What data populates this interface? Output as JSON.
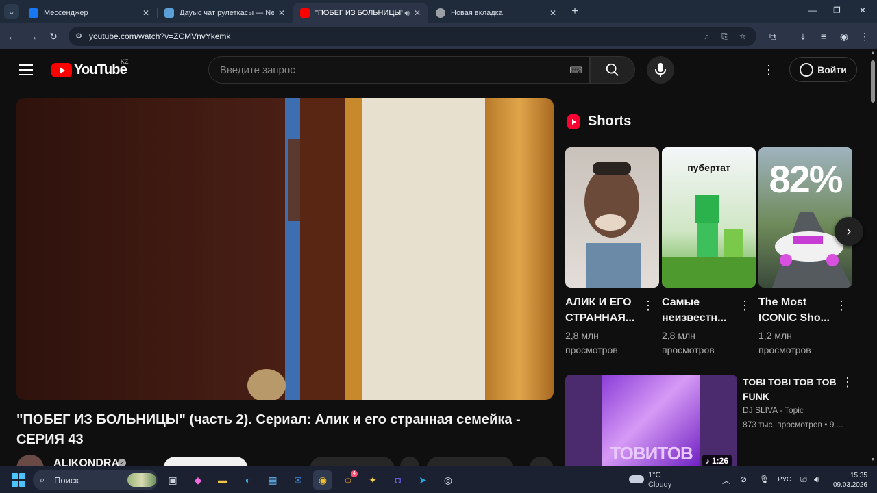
{
  "browser": {
    "tabs": [
      {
        "label": "Мессенджер",
        "favicon_color": "#1877f2"
      },
      {
        "label": "Дауыс чат рулеткасы — Nekto",
        "favicon_color": "#5aa0d6"
      },
      {
        "label": "\"ПОБЕГ ИЗ БОЛЬНИЦЫ\" (ч",
        "favicon_color": "#ff0000"
      },
      {
        "label": "Новая вкладка",
        "favicon_color": "#9aa0a6"
      }
    ],
    "url": "youtube.com/watch?v=ZCMVnvYkemk"
  },
  "header": {
    "logo_text": "YouTube",
    "country_code": "KZ",
    "search_placeholder": "Введите запрос",
    "signin_label": "Войти"
  },
  "video": {
    "title": "\"ПОБЕГ ИЗ БОЛЬНИЦЫ\" (часть 2). Сериал: Алик и его странная семейка - СЕРИЯ 43",
    "channel": "ALIKONDRA"
  },
  "shorts": {
    "section_title": "Shorts",
    "items": [
      {
        "title_line1": "АЛИК И ЕГО",
        "title_line2": "СТРАННАЯ...",
        "views_line1": "2,8 млн",
        "views_line2": "просмотров"
      },
      {
        "title_line1": "Самые",
        "title_line2": "неизвестн...",
        "views_line1": "2,8 млн",
        "views_line2": "просмотров",
        "thumb_text": "пубертат"
      },
      {
        "title_line1": "The Most",
        "title_line2": "ICONIC Sho...",
        "views_line1": "1,2 млн",
        "views_line2": "просмотров",
        "thumb_text": "82%"
      }
    ]
  },
  "recommended": {
    "title": "TOBI TOBI TOB TOB FUNK",
    "channel": "DJ SLIVA - Topic",
    "views": "873 тыс. просмотров • 9 ...",
    "duration": "1:26",
    "thumb_text": "TOBИTOB"
  },
  "taskbar": {
    "search_label": "Поиск",
    "weather_temp": "1°C",
    "weather_desc": "Cloudy",
    "lang": "РУС",
    "time": "15:35",
    "date": "09.03.2026",
    "badge_count": "4"
  }
}
